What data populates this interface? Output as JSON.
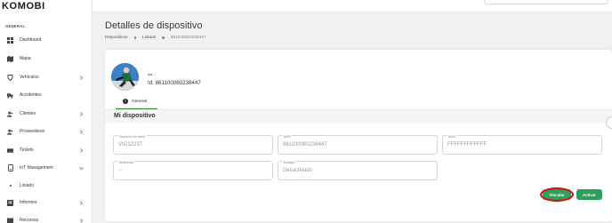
{
  "app": {
    "logo": "KOMOBI"
  },
  "sidebar": {
    "section_label": "GENERAL",
    "items": [
      {
        "label": "Dashboard",
        "icon": "grid-icon",
        "chevron": ""
      },
      {
        "label": "Mapa",
        "icon": "map-icon",
        "chevron": ""
      },
      {
        "label": "Vehículos",
        "icon": "car-icon",
        "chevron": "right"
      },
      {
        "label": "Accidentes",
        "icon": "truck-icon",
        "chevron": ""
      },
      {
        "label": "Clientes",
        "icon": "users-icon",
        "chevron": "right"
      },
      {
        "label": "Proveedores",
        "icon": "users-icon",
        "chevron": "right"
      },
      {
        "label": "Tickets",
        "icon": "ticket-icon",
        "chevron": "right"
      },
      {
        "label": "IoT Management",
        "icon": "device-icon",
        "chevron": "down"
      },
      {
        "label": "Listado",
        "icon": "dot-icon",
        "chevron": ""
      },
      {
        "label": "Informes",
        "icon": "report-icon",
        "chevron": "right"
      },
      {
        "label": "Recursos",
        "icon": "folder-icon",
        "chevron": "right"
      }
    ]
  },
  "page": {
    "title": "Detalles de dispositivo",
    "breadcrumb": [
      "Dispositivos",
      "Listado",
      "861100060238447"
    ]
  },
  "device": {
    "name": "--",
    "id_text": "Id: 861100060238447"
  },
  "tabs": [
    {
      "label": "General",
      "icon": "info-icon"
    }
  ],
  "section": {
    "title": "Mi dispositivo"
  },
  "fields": [
    {
      "label": "Numero de serie",
      "value": "VIG12237"
    },
    {
      "label": "IMEI",
      "value": "861100060238447"
    },
    {
      "label": "MAC",
      "value": "FFFFFFFFFFFF"
    },
    {
      "label": "Matricula",
      "value": "--"
    },
    {
      "label": "Estado",
      "value": "Desactivado"
    }
  ],
  "actions": {
    "link_label": "Vincular",
    "activate_label": "Activar"
  },
  "colors": {
    "accent_green": "#2e9e5a",
    "highlight_red": "#d21010",
    "avatar_blue": "#3b82c4"
  }
}
